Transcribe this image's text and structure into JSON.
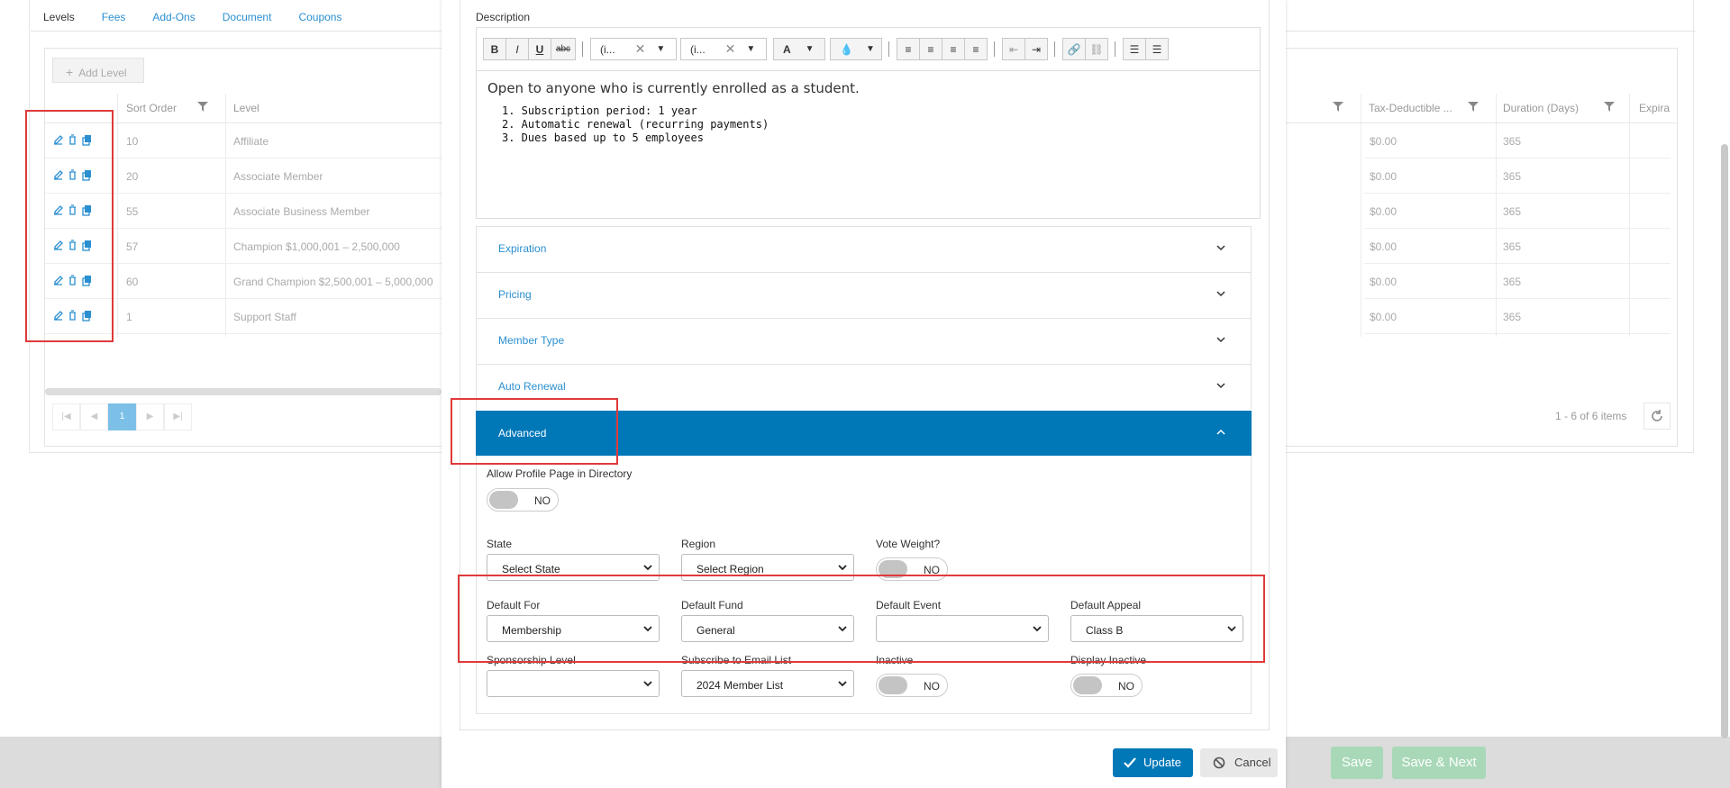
{
  "tabs": [
    "Levels",
    "Fees",
    "Add-Ons",
    "Document",
    "Coupons"
  ],
  "add_level": "Add Level",
  "columns": {
    "sort_order": "Sort Order",
    "level": "Level",
    "tax_deductible": "Tax-Deductible ...",
    "duration": "Duration (Days)",
    "expiration": "Expira"
  },
  "rows": [
    {
      "sort": "10",
      "level": "Affiliate",
      "tax": "$0.00",
      "duration": "365"
    },
    {
      "sort": "20",
      "level": "Associate Member",
      "tax": "$0.00",
      "duration": "365"
    },
    {
      "sort": "55",
      "level": "Associate Business Member",
      "tax": "$0.00",
      "duration": "365"
    },
    {
      "sort": "57",
      "level": "Champion $1,000,001 – 2,500,000",
      "tax": "$0.00",
      "duration": "365"
    },
    {
      "sort": "60",
      "level": "Grand Champion $2,500,001 – 5,000,000",
      "tax": "$0.00",
      "duration": "365"
    },
    {
      "sort": "1",
      "level": "Support Staff",
      "tax": "$0.00",
      "duration": "365"
    }
  ],
  "pager": {
    "current": "1",
    "summary": "1 - 6 of 6 items"
  },
  "footer": {
    "save": "Save",
    "save_next": "Save & Next"
  },
  "modal": {
    "description_label": "Description",
    "toolbar": {
      "bold": "B",
      "italic": "I",
      "underline": "U",
      "strike": "abc",
      "font": "(i...",
      "size": "(i...",
      "color": "A"
    },
    "body_paragraph": "Open to anyone who is currently enrolled as a student.",
    "body_list": [
      "1. Subscription period: 1 year",
      "2. Automatic renewal (recurring payments)",
      "3. Dues based up to 5 employees"
    ],
    "sections": [
      "Expiration",
      "Pricing",
      "Member Type",
      "Auto Renewal",
      "Advanced"
    ],
    "allow_profile_label": "Allow Profile Page in Directory",
    "allow_profile_value": "NO",
    "state_label": "State",
    "state_value": "Select State",
    "region_label": "Region",
    "region_value": "Select Region",
    "vote_label": "Vote Weight?",
    "vote_value": "NO",
    "default_for_label": "Default For",
    "default_for_value": "Membership",
    "default_fund_label": "Default Fund",
    "default_fund_value": "General",
    "default_event_label": "Default Event",
    "default_event_value": "",
    "default_appeal_label": "Default Appeal",
    "default_appeal_value": "Class B",
    "sponsorship_label": "Sponsorship Level",
    "sponsorship_value": "",
    "email_list_label": "Subscribe to Email List",
    "email_list_value": "2024 Member List",
    "inactive_label": "Inactive",
    "inactive_value": "NO",
    "display_inactive_label": "Display Inactive",
    "display_inactive_value": "NO",
    "update": "Update",
    "cancel": "Cancel"
  },
  "colors": {
    "accent": "#0078b8",
    "link": "#2b8fd0",
    "highlight": "#e03a3a",
    "save_green": "#a8d8b8"
  }
}
